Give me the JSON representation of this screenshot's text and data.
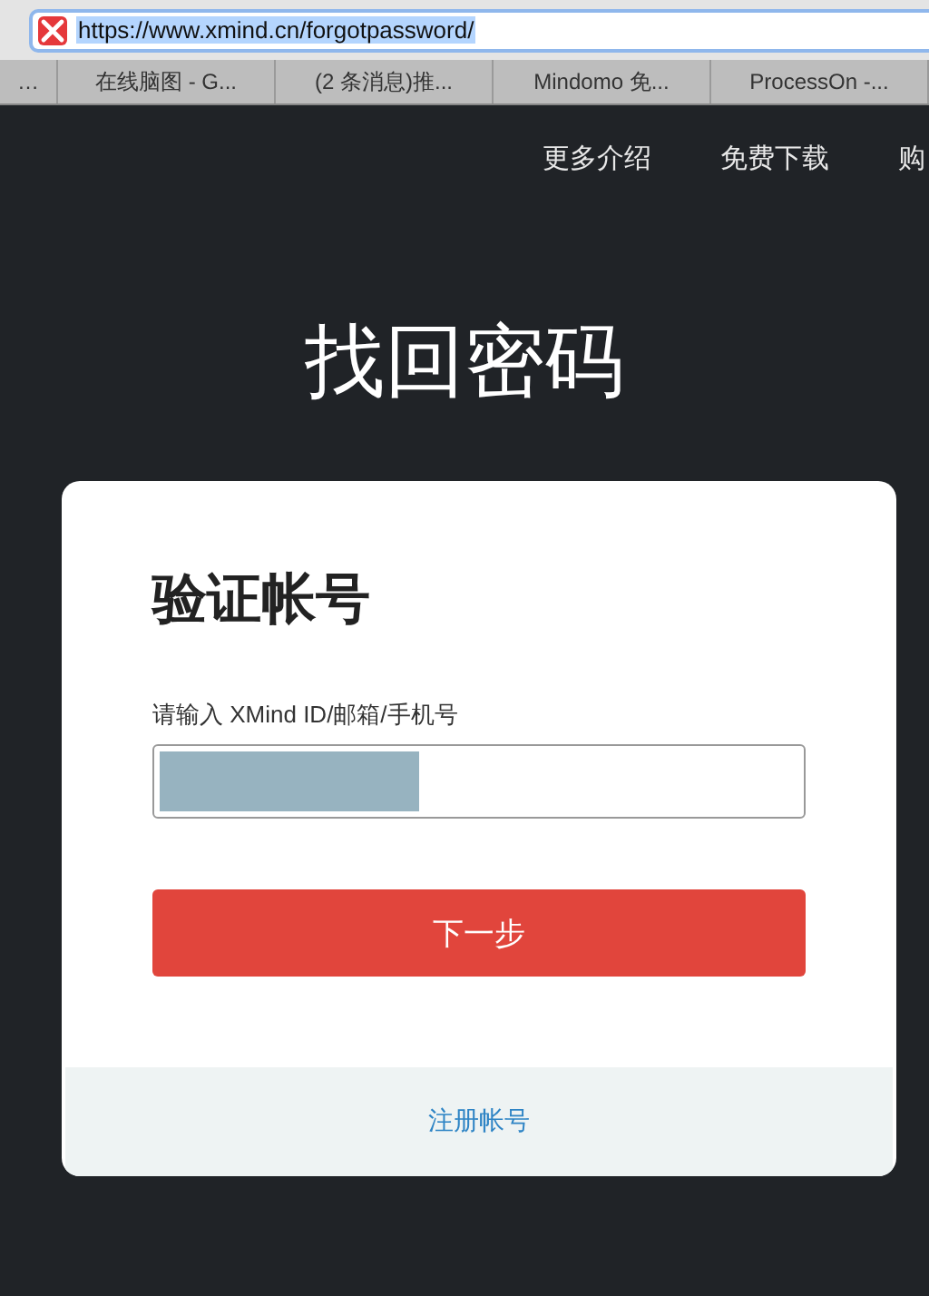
{
  "browser": {
    "url": "https://www.xmind.cn/forgotpassword/",
    "url_selected": true,
    "tabs": [
      {
        "label": "…",
        "selected": false
      },
      {
        "label": "在线脑图 - G...",
        "selected": false
      },
      {
        "label": "(2 条消息)推...",
        "selected": false
      },
      {
        "label": "Mindomo 免...",
        "selected": false
      },
      {
        "label": "ProcessOn -...",
        "selected": false
      }
    ]
  },
  "nav": [
    "更多介绍",
    "免费下载",
    "购"
  ],
  "title": "找回密码",
  "card": {
    "heading": "验证帐号",
    "field_label": "请输入 XMind ID/邮箱/手机号",
    "value_redacted": true,
    "button": "下一步",
    "footer_link": "注册帐号"
  }
}
